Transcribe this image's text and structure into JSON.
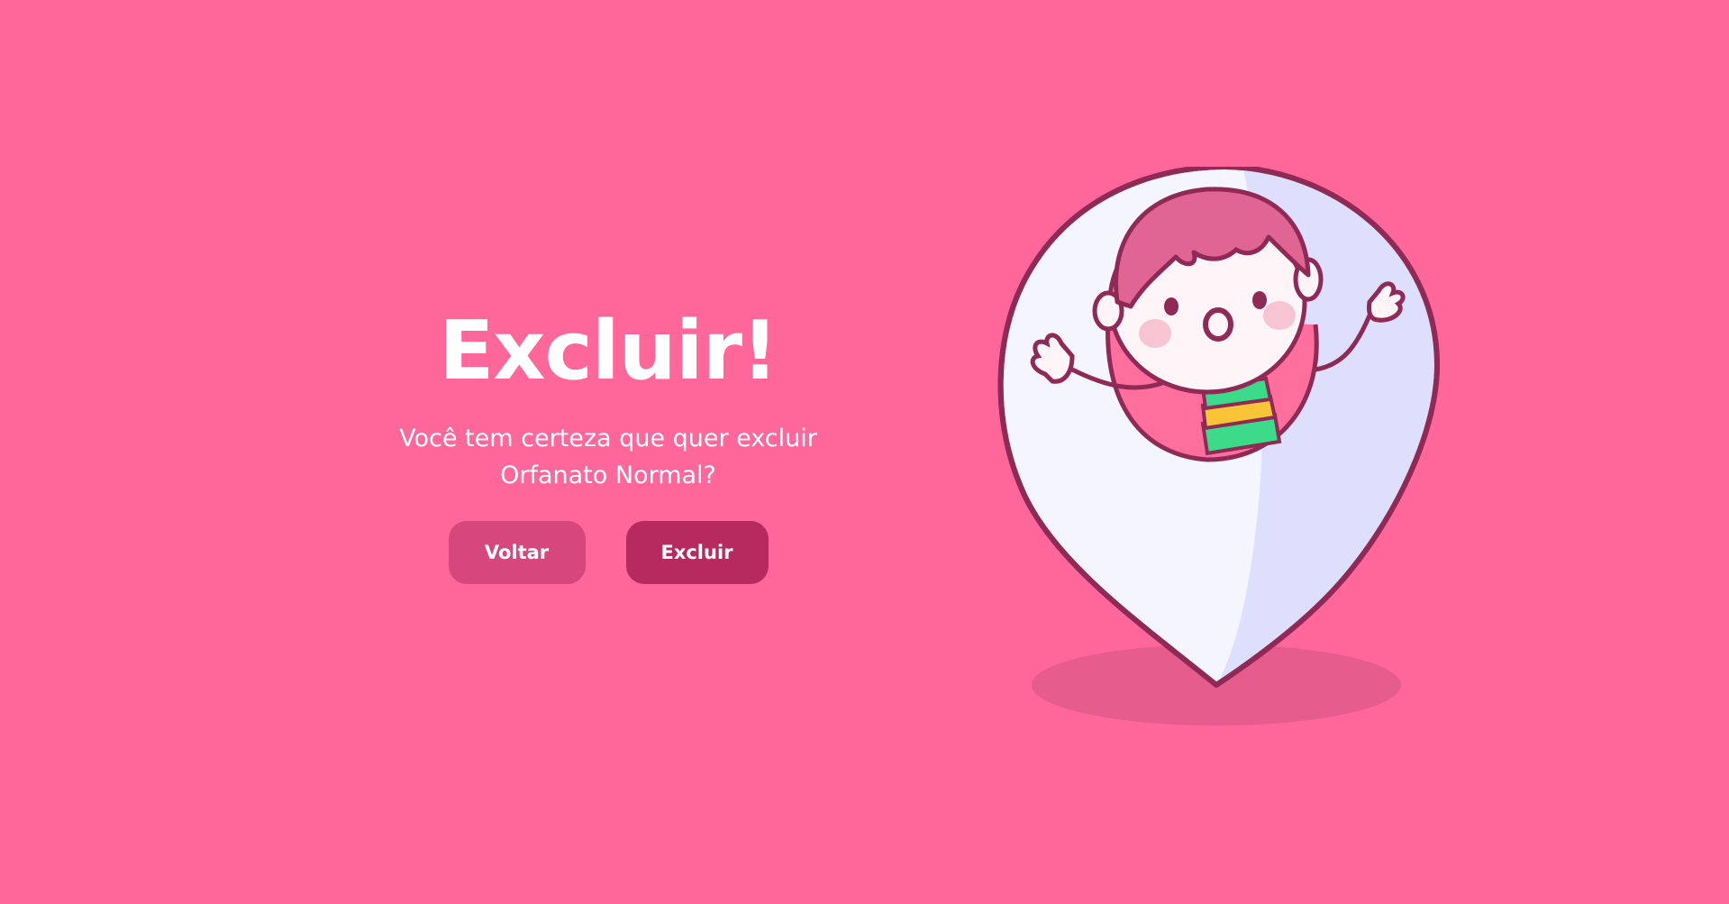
{
  "page": {
    "title": "Excluir!",
    "message": "Você tem certeza que quer excluir Orfanato Normal?"
  },
  "buttons": {
    "back_label": "Voltar",
    "delete_label": "Excluir"
  },
  "illustration": {
    "description_icon": "map-pin-child-icon"
  },
  "colors": {
    "background": "#FF669A",
    "back_button": "#D6487B",
    "delete_button": "#B72A5D",
    "text": "#FFFFFF",
    "pin_outline": "#8E2A55",
    "pin_fill_light": "#F5F5FF",
    "pin_fill_shade": "#DEDFFC",
    "shadow": "#E55C8D"
  }
}
